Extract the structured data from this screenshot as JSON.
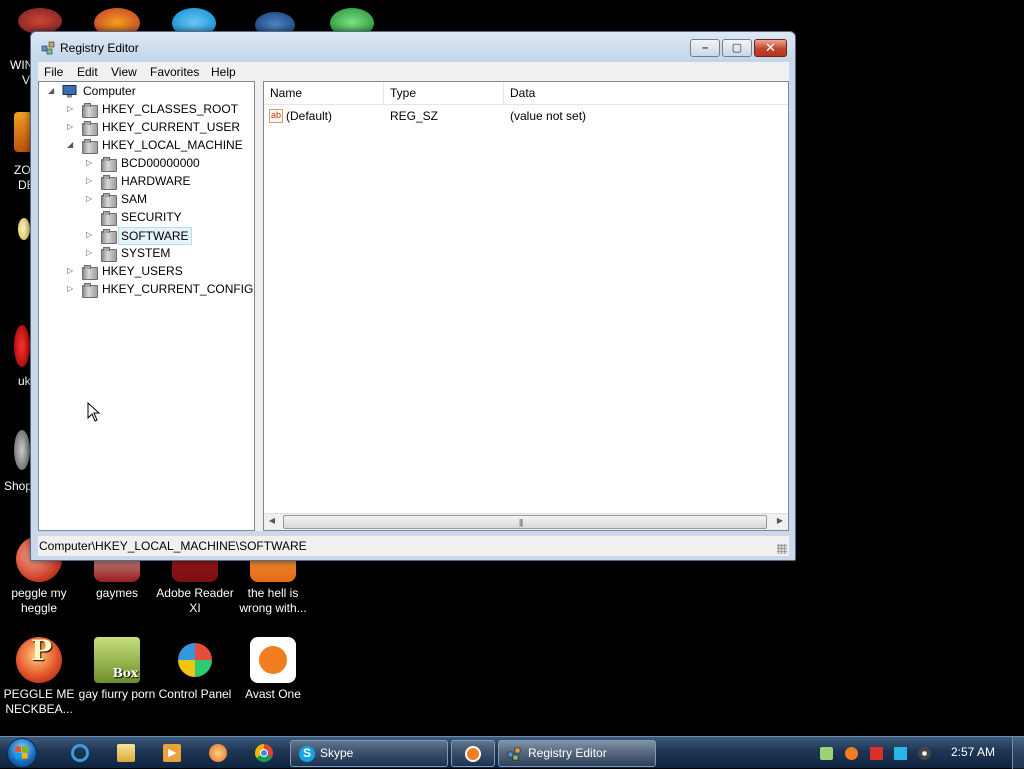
{
  "desktop": {
    "partial_labels": [
      "WIN",
      "V",
      "ZO",
      "DE",
      "uk",
      "Shop"
    ],
    "icons_row1": [
      {
        "label": "peggle my heggle",
        "icon": "peggle-icon"
      },
      {
        "label": "gaymes",
        "icon": "folder-icon"
      },
      {
        "label": "Adobe Reader XI",
        "icon": "adobe-reader-icon"
      },
      {
        "label": "the hell is wrong with...",
        "icon": "shortcut-icon"
      }
    ],
    "icons_row2": [
      {
        "label": "PEGGLE ME NECKBEA...",
        "icon": "peggle-icon"
      },
      {
        "label": "gay fiurry porn",
        "icon": "box-game-icon",
        "badge": "Box"
      },
      {
        "label": "Control Panel",
        "icon": "control-panel-icon"
      },
      {
        "label": "Avast One",
        "icon": "avast-icon"
      }
    ]
  },
  "window": {
    "title": "Registry Editor",
    "menu": [
      "File",
      "Edit",
      "View",
      "Favorites",
      "Help"
    ],
    "tree": {
      "root": "Computer",
      "hives": [
        "HKEY_CLASSES_ROOT",
        "HKEY_CURRENT_USER",
        "HKEY_LOCAL_MACHINE"
      ],
      "hklm_children": [
        "BCD00000000",
        "HARDWARE",
        "SAM",
        "SECURITY",
        "SOFTWARE",
        "SYSTEM"
      ],
      "hives_after": [
        "HKEY_USERS",
        "HKEY_CURRENT_CONFIG"
      ],
      "selected": "SOFTWARE"
    },
    "list": {
      "columns": [
        "Name",
        "Type",
        "Data"
      ],
      "rows": [
        {
          "name": "(Default)",
          "type": "REG_SZ",
          "data": "(value not set)",
          "icon": "string-value-icon",
          "icon_text": "ab"
        }
      ]
    },
    "status": "Computer\\HKEY_LOCAL_MACHINE\\SOFTWARE",
    "buttons": {
      "minimize": "–",
      "maximize": "▢",
      "close": "✕"
    }
  },
  "taskbar": {
    "pinned": [
      "internet-explorer-icon",
      "file-explorer-icon",
      "media-player-icon",
      "paint-icon",
      "chrome-icon"
    ],
    "tasks": [
      {
        "label": "Skype",
        "icon": "skype-icon"
      },
      {
        "label": "",
        "icon": "avast-icon"
      },
      {
        "label": "Registry Editor",
        "icon": "regedit-icon"
      }
    ],
    "clock": "2:57 AM"
  },
  "colors": {
    "accent": "#1a6fbe",
    "selection": "#e5f3fb",
    "close_button": "#c3432b",
    "avast_orange": "#f07d1e"
  }
}
